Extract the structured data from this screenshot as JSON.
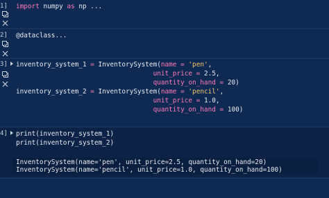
{
  "cells": [
    {
      "prompt": "1]",
      "lines": [
        [
          {
            "t": "import",
            "c": "kw"
          },
          {
            "t": " numpy ",
            "c": ""
          },
          {
            "t": "as",
            "c": "kw"
          },
          {
            "t": " np ...",
            "c": ""
          }
        ]
      ]
    },
    {
      "prompt": "2]",
      "lines": [
        [
          {
            "t": "@dataclass...",
            "c": "dec"
          }
        ]
      ]
    },
    {
      "prompt": "3]",
      "lines": [
        [
          {
            "t": "inventory_system_1 ",
            "c": ""
          },
          {
            "t": "=",
            "c": "op"
          },
          {
            "t": " InventorySystem(",
            "c": ""
          },
          {
            "t": "name",
            "c": "param"
          },
          {
            "t": " ",
            "c": ""
          },
          {
            "t": "=",
            "c": "op"
          },
          {
            "t": " ",
            "c": ""
          },
          {
            "t": "'pen'",
            "c": "str"
          },
          {
            "t": ",",
            "c": ""
          }
        ],
        [
          {
            "t": "                                   ",
            "c": ""
          },
          {
            "t": "unit_price",
            "c": "param"
          },
          {
            "t": " ",
            "c": ""
          },
          {
            "t": "=",
            "c": "op"
          },
          {
            "t": " 2.5,",
            "c": ""
          }
        ],
        [
          {
            "t": "                                   ",
            "c": ""
          },
          {
            "t": "quantity_on_hand",
            "c": "param"
          },
          {
            "t": " ",
            "c": ""
          },
          {
            "t": "=",
            "c": "op"
          },
          {
            "t": " 20)",
            "c": ""
          }
        ],
        [
          {
            "t": "inventory_system_2 ",
            "c": ""
          },
          {
            "t": "=",
            "c": "op"
          },
          {
            "t": " InventorySystem(",
            "c": ""
          },
          {
            "t": "name",
            "c": "param"
          },
          {
            "t": " ",
            "c": ""
          },
          {
            "t": "=",
            "c": "op"
          },
          {
            "t": " ",
            "c": ""
          },
          {
            "t": "'pencil'",
            "c": "str"
          },
          {
            "t": ",",
            "c": ""
          }
        ],
        [
          {
            "t": "                                   ",
            "c": ""
          },
          {
            "t": "unit_price",
            "c": "param"
          },
          {
            "t": " ",
            "c": ""
          },
          {
            "t": "=",
            "c": "op"
          },
          {
            "t": " 1.0,",
            "c": ""
          }
        ],
        [
          {
            "t": "                                   ",
            "c": ""
          },
          {
            "t": "quantity_on_hand",
            "c": "param"
          },
          {
            "t": " ",
            "c": ""
          },
          {
            "t": "=",
            "c": "op"
          },
          {
            "t": " 100)",
            "c": ""
          }
        ]
      ]
    },
    {
      "prompt": "4]",
      "lines": [
        [
          {
            "t": "print(inventory_system_1)",
            "c": ""
          }
        ],
        [
          {
            "t": "print(inventory_system_2)",
            "c": ""
          }
        ]
      ],
      "output": [
        "InventorySystem(name='pen', unit_price=2.5, quantity_on_hand=20)",
        "InventorySystem(name='pencil', unit_price=1.0, quantity_on_hand=100)"
      ]
    }
  ],
  "icons": {
    "run_by_line": "run-by-line-icon",
    "delete": "close-icon",
    "collapse": "chevron-right-icon"
  },
  "colors": {
    "background": "#0f2a52",
    "keyword": "#ff7ab8",
    "string": "#f7c56b",
    "text": "#e6eaf0"
  }
}
